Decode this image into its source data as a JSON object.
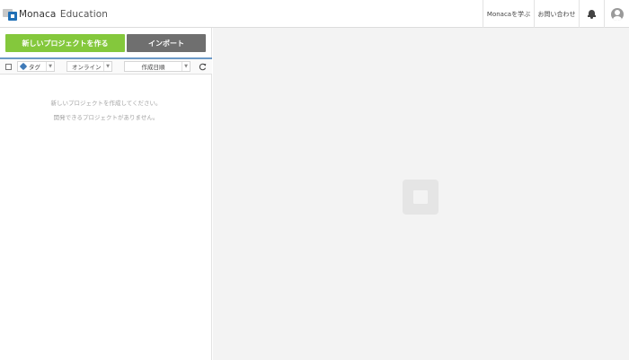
{
  "header": {
    "logo_main": "Monaca",
    "logo_sub": "Education",
    "nav_learn": "Monacaを学ぶ",
    "nav_contact": "お問い合わせ"
  },
  "toolbar": {
    "new_project_label": "新しいプロジェクトを作る",
    "import_label": "インポート"
  },
  "filters": {
    "tag_label": "タグ",
    "online_label": "オンライン",
    "sort_label": "作成日順"
  },
  "empty_state": {
    "line1": "新しいプロジェクトを作成してください。",
    "line2": "開発できるプロジェクトがありません。"
  },
  "colors": {
    "primary_green": "#84c83c",
    "import_gray": "#6f6f6f",
    "accent_blue": "#6c99c7",
    "brand_blue": "#1f6fb6"
  },
  "icons": [
    "monaca-logo-icon",
    "bell-icon",
    "user-avatar-icon",
    "tag-icon",
    "refresh-icon",
    "chevron-down-icon",
    "placeholder-icon"
  ]
}
